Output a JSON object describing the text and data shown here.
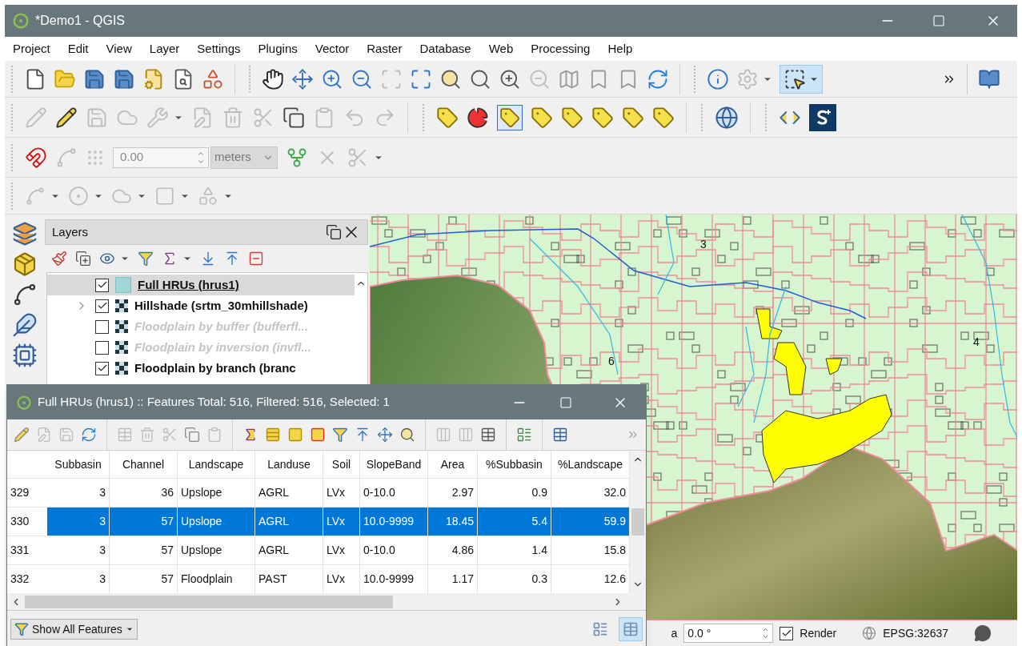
{
  "window": {
    "title": "*Demo1 - QGIS"
  },
  "menu": [
    "Project",
    "Edit",
    "View",
    "Layer",
    "Settings",
    "Plugins",
    "Vector",
    "Raster",
    "Database",
    "Web",
    "Processing",
    "Help"
  ],
  "select_button": {
    "selected": true
  },
  "pin_labels_button": {
    "selected": true
  },
  "snapping": {
    "tolerance": "0.00",
    "units": "meters"
  },
  "layers_panel": {
    "title": "Layers",
    "layers": [
      {
        "name": "Full HRUs (hrus1)",
        "kind": "vector",
        "checked": true,
        "selected": true,
        "expandable": false
      },
      {
        "name": "Hillshade (srtm_30mhillshade)",
        "kind": "raster",
        "checked": true,
        "selected": false,
        "expandable": true
      },
      {
        "name": "Floodplain by buffer (bufferfl...",
        "kind": "raster",
        "checked": false,
        "selected": false,
        "expandable": false
      },
      {
        "name": "Floodplain by inversion (invfl...",
        "kind": "raster",
        "checked": false,
        "selected": false,
        "expandable": false
      },
      {
        "name": "Floodplain by branch (branc",
        "kind": "raster",
        "checked": true,
        "selected": false,
        "expandable": false
      }
    ]
  },
  "map": {
    "labels": [
      "3",
      "6",
      "4"
    ]
  },
  "attribute_table": {
    "title": "Full HRUs (hrus1) :: Features Total: 516, Filtered: 516, Selected: 1",
    "columns": [
      {
        "label": "Subbasin",
        "kind": "number"
      },
      {
        "label": "Channel",
        "kind": "number"
      },
      {
        "label": "Landscape",
        "kind": "text"
      },
      {
        "label": "Landuse",
        "kind": "text"
      },
      {
        "label": "Soil",
        "kind": "text"
      },
      {
        "label": "SlopeBand",
        "kind": "text"
      },
      {
        "label": "Area",
        "kind": "number"
      },
      {
        "label": "%Subbasin",
        "kind": "number"
      },
      {
        "label": "%Landscape",
        "kind": "number"
      }
    ],
    "rows": [
      {
        "id": "329",
        "selected": false,
        "cells": [
          "3",
          "36",
          "Upslope",
          "AGRL",
          "LVx",
          "0-10.0",
          "2.97",
          "0.9",
          "32.0"
        ]
      },
      {
        "id": "330",
        "selected": true,
        "cells": [
          "3",
          "57",
          "Upslope",
          "AGRL",
          "LVx",
          "10.0-9999",
          "18.45",
          "5.4",
          "59.9"
        ]
      },
      {
        "id": "331",
        "selected": false,
        "cells": [
          "3",
          "57",
          "Upslope",
          "AGRL",
          "LVx",
          "0-10.0",
          "4.86",
          "1.4",
          "15.8"
        ]
      },
      {
        "id": "332",
        "selected": false,
        "cells": [
          "3",
          "57",
          "Floodplain",
          "PAST",
          "LVx",
          "10.0-9999",
          "1.17",
          "0.3",
          "12.6"
        ]
      }
    ],
    "filter_button": "Show All Features",
    "views": [
      {
        "kind": "form",
        "selected": false
      },
      {
        "kind": "table",
        "selected": true
      }
    ]
  },
  "status_bar": {
    "label_fragment": "a",
    "rotation": "0.0 °",
    "render": {
      "label": "Render",
      "checked": true
    },
    "crs": "EPSG:32637"
  }
}
